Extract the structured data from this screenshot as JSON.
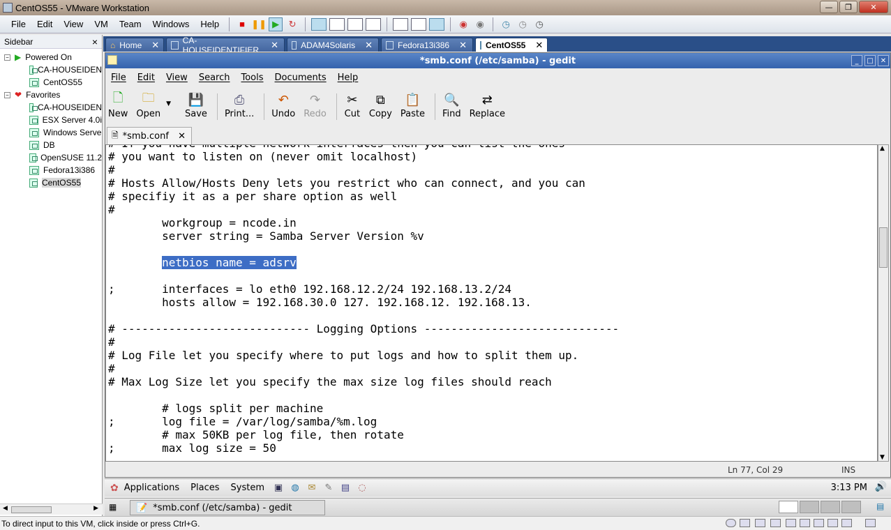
{
  "host": {
    "title": "CentOS55 - VMware Workstation",
    "menu": [
      "File",
      "Edit",
      "View",
      "VM",
      "Team",
      "Windows",
      "Help"
    ],
    "status_text": "To direct input to this VM, click inside or press Ctrl+G."
  },
  "sidebar": {
    "title": "Sidebar",
    "close_label": "×",
    "groups": [
      {
        "label": "Powered On",
        "items": [
          "CA-HOUSEIDEN",
          "CentOS55"
        ]
      },
      {
        "label": "Favorites",
        "items": [
          "CA-HOUSEIDEN",
          "ESX Server 4.0i",
          "Windows Serve",
          "DB",
          "OpenSUSE 11.2",
          "Fedora13i386",
          "CentOS55"
        ]
      }
    ]
  },
  "vm_tabs": [
    "Home",
    "CA-HOUSEIDENTIFIER",
    "ADAM4Solaris",
    "Fedora13i386",
    "CentOS55"
  ],
  "gedit": {
    "title": "*smb.conf (/etc/samba) - gedit",
    "menu": [
      "File",
      "Edit",
      "View",
      "Search",
      "Tools",
      "Documents",
      "Help"
    ],
    "toolbar": {
      "new": "New",
      "open": "Open",
      "save": "Save",
      "print": "Print...",
      "undo": "Undo",
      "redo": "Redo",
      "cut": "Cut",
      "copy": "Copy",
      "paste": "Paste",
      "find": "Find",
      "replace": "Replace"
    },
    "doc_tab": "*smb.conf",
    "lines": [
      "# If you have multiple network interfaces then you can list the ones",
      "# you want to listen on (never omit localhost)",
      "#",
      "# Hosts Allow/Hosts Deny lets you restrict who can connect, and you can",
      "# specifiy it as a per share option as well",
      "#",
      "\tworkgroup = ncode.in",
      "\tserver string = Samba Server Version %v",
      "",
      "\tnetbios name = adsrv",
      "",
      ";\tinterfaces = lo eth0 192.168.12.2/24 192.168.13.2/24",
      "\thosts allow = 192.168.30.0 127. 192.168.12. 192.168.13.",
      "",
      "# ---------------------------- Logging Options -----------------------------",
      "#",
      "# Log File let you specify where to put logs and how to split them up.",
      "#",
      "# Max Log Size let you specify the max size log files should reach",
      "",
      "\t# logs split per machine",
      ";\tlog file = /var/log/samba/%m.log",
      "\t# max 50KB per log file, then rotate",
      ";\tmax log size = 50"
    ],
    "selected_line_index": 9,
    "status": {
      "position": "Ln 77, Col 29",
      "mode": "INS"
    }
  },
  "gnome": {
    "menu": [
      "Applications",
      "Places",
      "System"
    ],
    "clock": "3:13 PM",
    "task": "*smb.conf (/etc/samba) - gedit"
  }
}
